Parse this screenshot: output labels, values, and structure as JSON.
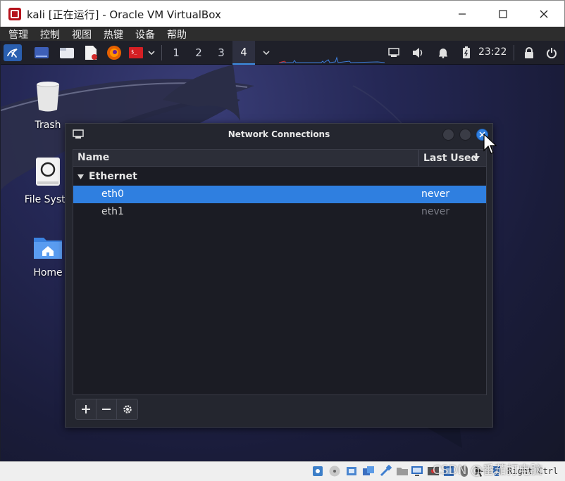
{
  "window": {
    "title": "kali [正在运行] - Oracle VM VirtualBox",
    "menu": [
      "管理",
      "控制",
      "视图",
      "热键",
      "设备",
      "帮助"
    ]
  },
  "panel": {
    "workspaces": [
      "1",
      "2",
      "3",
      "4"
    ],
    "active_workspace": "4",
    "clock": "23:22"
  },
  "desktop": {
    "icons": [
      {
        "label": "Trash",
        "icon": "trash-icon"
      },
      {
        "label": "File Syste",
        "icon": "drive-icon"
      },
      {
        "label": "Home",
        "icon": "home-folder-icon"
      }
    ]
  },
  "dialog": {
    "title": "Network Connections",
    "columns": {
      "name": "Name",
      "last_used": "Last Used"
    },
    "group": "Ethernet",
    "connections": [
      {
        "name": "eth0",
        "last_used": "never",
        "selected": true
      },
      {
        "name": "eth1",
        "last_used": "never",
        "selected": false
      }
    ],
    "toolbar": [
      "add-icon",
      "remove-icon",
      "settings-icon"
    ]
  },
  "statusbar": {
    "host_key": "Right Ctrl",
    "watermark": "CSDN @番茄打电脑"
  },
  "colors": {
    "selection": "#2f7fe0",
    "panel_bg": "#1f2029",
    "dialog_bg": "#24262f"
  }
}
